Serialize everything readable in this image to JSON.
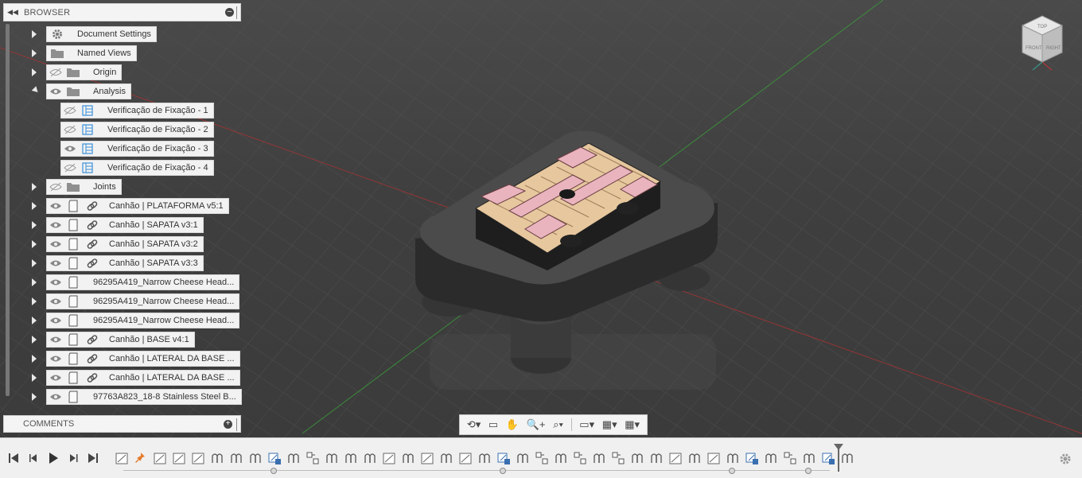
{
  "browser": {
    "title": "BROWSER",
    "items": [
      {
        "label": "Document Settings",
        "icon": "gear-icon",
        "expander": "right"
      },
      {
        "label": "Named Views",
        "icon": "folder-icon",
        "expander": "right"
      },
      {
        "label": "Origin",
        "icon": "folder-icon",
        "eye": "hidden",
        "expander": "right"
      },
      {
        "label": "Analysis",
        "icon": "folder-icon",
        "eye": "visible",
        "expander": "down"
      },
      {
        "label": "Verificação de Fixação - 1",
        "icon": "analysis-icon",
        "eye": "hidden"
      },
      {
        "label": "Verificação de Fixação - 2",
        "icon": "analysis-icon",
        "eye": "hidden"
      },
      {
        "label": "Verificação de Fixação - 3",
        "icon": "analysis-icon",
        "eye": "visible"
      },
      {
        "label": "Verificação de Fixação - 4",
        "icon": "analysis-icon",
        "eye": "hidden"
      },
      {
        "label": "Joints",
        "icon": "folder-icon",
        "eye": "hidden",
        "expander": "right"
      },
      {
        "label": "Canhão | PLATAFORMA v5:1",
        "icon": "component-icon",
        "eye": "visible",
        "link": true,
        "expander": "right"
      },
      {
        "label": "Canhão | SAPATA v3:1",
        "icon": "component-icon",
        "eye": "visible",
        "link": true,
        "expander": "right"
      },
      {
        "label": "Canhão | SAPATA v3:2",
        "icon": "component-icon",
        "eye": "visible",
        "link": true,
        "expander": "right"
      },
      {
        "label": "Canhão | SAPATA v3:3",
        "icon": "component-icon",
        "eye": "visible",
        "link": true,
        "expander": "right"
      },
      {
        "label": "96295A419_Narrow Cheese Head...",
        "icon": "component-icon",
        "eye": "visible",
        "expander": "right"
      },
      {
        "label": "96295A419_Narrow Cheese Head...",
        "icon": "component-icon",
        "eye": "visible",
        "expander": "right"
      },
      {
        "label": "96295A419_Narrow Cheese Head...",
        "icon": "component-icon",
        "eye": "visible",
        "expander": "right"
      },
      {
        "label": "Canhão | BASE v4:1",
        "icon": "component-icon",
        "eye": "visible",
        "link": true,
        "expander": "right"
      },
      {
        "label": "Canhão | LATERAL DA BASE ...",
        "icon": "component-icon",
        "eye": "visible",
        "link": true,
        "expander": "right"
      },
      {
        "label": "Canhão | LATERAL DA BASE ...",
        "icon": "component-icon",
        "eye": "visible",
        "link": true,
        "expander": "right"
      },
      {
        "label": "97763A823_18-8 Stainless Steel B...",
        "icon": "component-icon",
        "eye": "visible",
        "expander": "right"
      }
    ]
  },
  "comments": {
    "title": "COMMENTS"
  },
  "nav_toolbar": {
    "tools": [
      "orbit-icon",
      "look-at-icon",
      "pan-icon",
      "zoom-window-icon",
      "fit-icon",
      "display-settings-icon",
      "grid-icon",
      "viewports-icon"
    ]
  },
  "viewcube": {
    "faces": [
      "TOP",
      "FRONT",
      "RIGHT"
    ]
  },
  "timeline": {
    "controls": [
      "skip-start-icon",
      "step-back-icon",
      "play-icon",
      "step-forward-icon",
      "skip-end-icon"
    ],
    "features": [
      "sketch",
      "pin",
      "sketch",
      "sketch",
      "sketch",
      "joint",
      "joint",
      "joint",
      "joint-group",
      "joint",
      "rigid-group",
      "joint",
      "joint",
      "joint",
      "sketch",
      "joint",
      "sketch",
      "joint",
      "sketch",
      "joint",
      "joint-group",
      "joint",
      "rigid-group",
      "joint",
      "rigid-group",
      "joint",
      "rigid-group",
      "joint",
      "joint",
      "sketch",
      "joint",
      "sketch",
      "joint",
      "joint-group",
      "joint",
      "rigid-group",
      "joint",
      "joint-group",
      "joint"
    ]
  },
  "colors": {
    "accent": "#2a7ad5",
    "wood": "#e6c79e",
    "pink": "#e9b4bd",
    "body": "#2f2f2f"
  }
}
